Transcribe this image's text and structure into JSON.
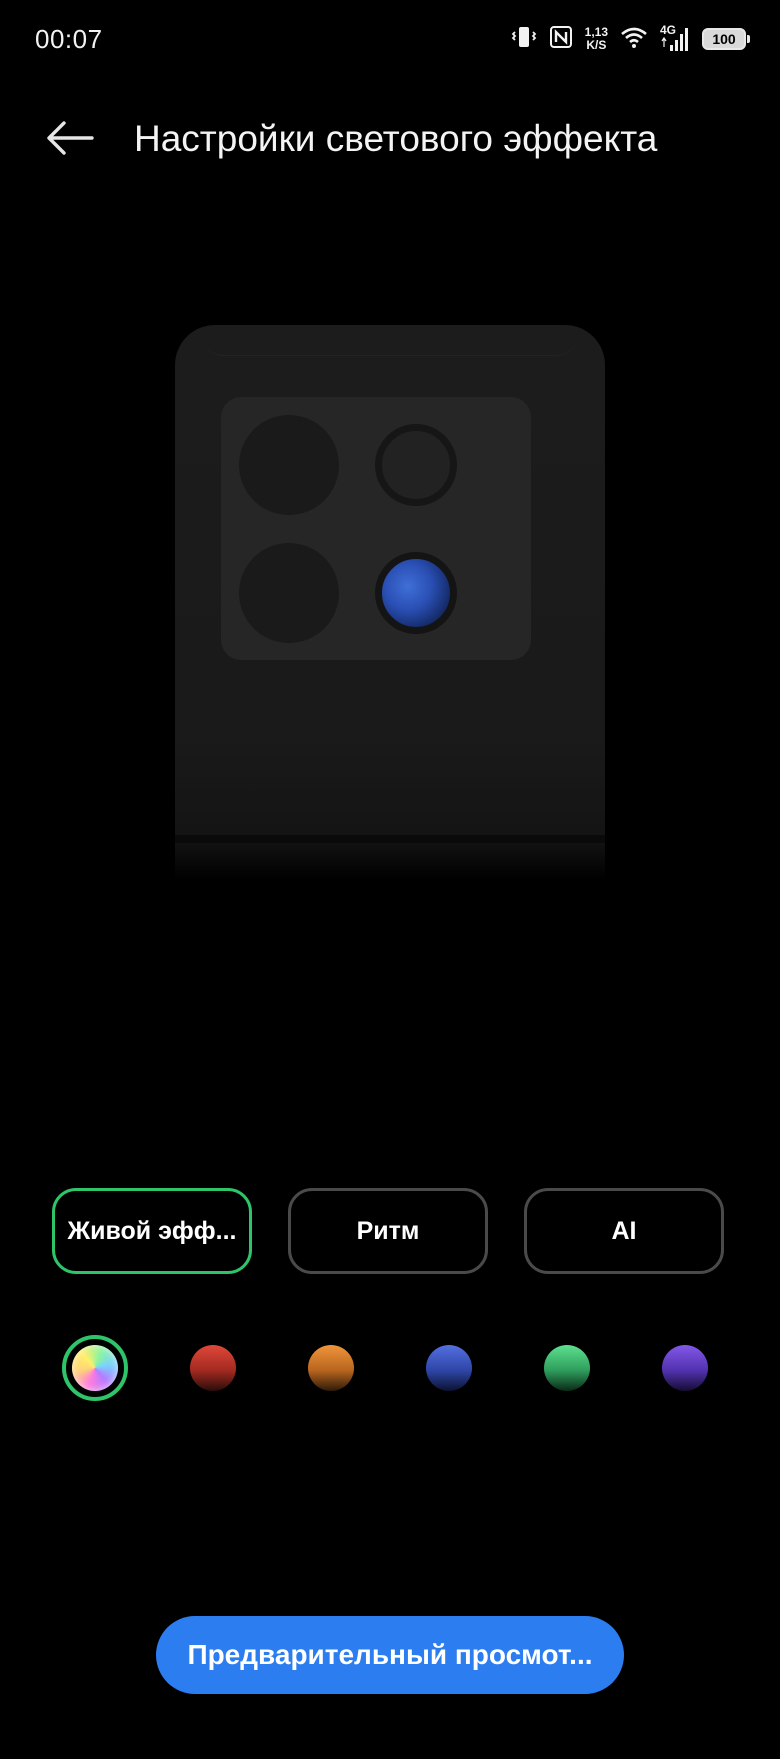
{
  "status_bar": {
    "time": "00:07",
    "net_speed_value": "1,13",
    "net_speed_unit": "K/S",
    "network_type": "4G",
    "battery": "100",
    "icons": [
      "vibrate-icon",
      "nfc-icon",
      "wifi-icon",
      "signal-icon",
      "battery-icon"
    ]
  },
  "header": {
    "title": "Настройки светового эффекта",
    "back_icon": "back-arrow-icon"
  },
  "modes": [
    {
      "label": "Живой эфф...",
      "selected": true
    },
    {
      "label": "Ритм",
      "selected": false
    },
    {
      "label": "AI",
      "selected": false
    }
  ],
  "colors": [
    {
      "name": "multicolor",
      "selected": true
    },
    {
      "name": "red",
      "color": "#c53a2c",
      "selected": false
    },
    {
      "name": "orange",
      "color": "#d9822b",
      "selected": false
    },
    {
      "name": "blue",
      "color": "#3e58c9",
      "selected": false
    },
    {
      "name": "green",
      "color": "#3ec978",
      "selected": false
    },
    {
      "name": "purple",
      "color": "#6a44c9",
      "selected": false
    }
  ],
  "preview_button": {
    "label": "Предварительный просмот..."
  },
  "theme": {
    "accent_green": "#2ec56a",
    "button_blue": "#2c7df0",
    "background": "#000000"
  }
}
